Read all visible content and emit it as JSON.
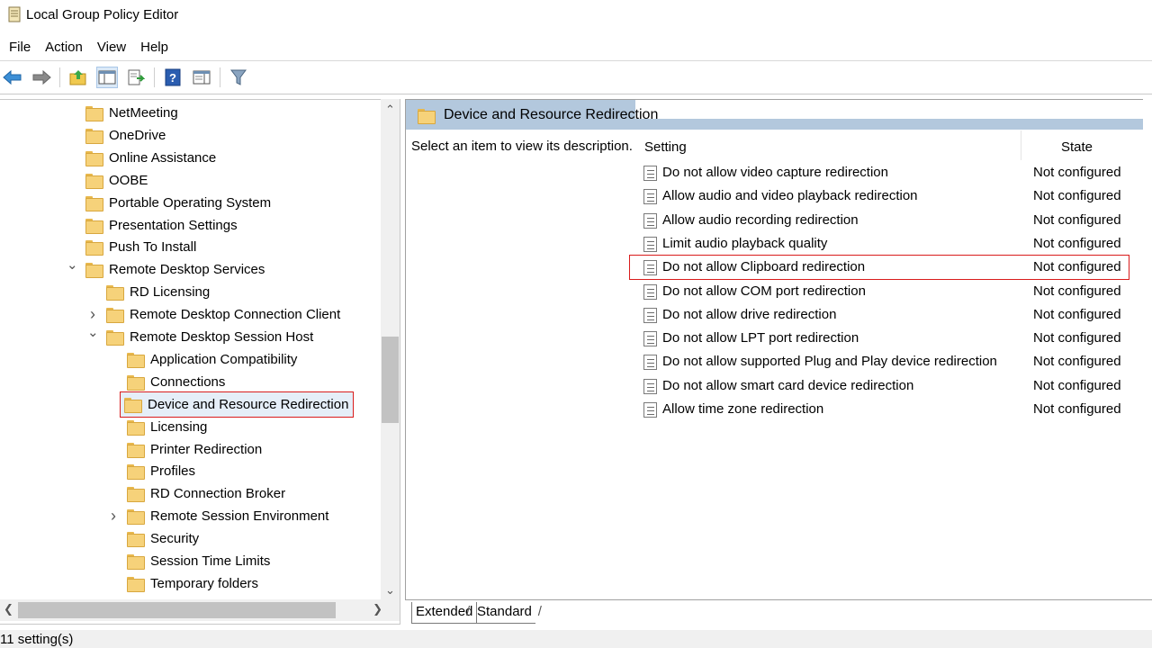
{
  "window": {
    "title": "Local Group Policy Editor"
  },
  "menu": [
    "File",
    "Action",
    "View",
    "Help"
  ],
  "toolbar": {
    "icons": [
      "back-arrow-icon",
      "forward-arrow-icon",
      "up-folder-icon",
      "show-hide-tree-icon",
      "export-list-icon",
      "help-icon",
      "properties-icon",
      "filter-icon"
    ]
  },
  "tree": {
    "items": [
      {
        "label": "NetMeeting",
        "level": 3
      },
      {
        "label": "OneDrive",
        "level": 3
      },
      {
        "label": "Online Assistance",
        "level": 3
      },
      {
        "label": "OOBE",
        "level": 3
      },
      {
        "label": "Portable Operating System",
        "level": 3
      },
      {
        "label": "Presentation Settings",
        "level": 3
      },
      {
        "label": "Push To Install",
        "level": 3
      },
      {
        "label": "Remote Desktop Services",
        "level": 3,
        "expander": "expanded"
      },
      {
        "label": "RD Licensing",
        "level": 4
      },
      {
        "label": "Remote Desktop Connection Client",
        "level": 4,
        "expander": "collapsed"
      },
      {
        "label": "Remote Desktop Session Host",
        "level": 4,
        "expander": "expanded"
      },
      {
        "label": "Application Compatibility",
        "level": 5
      },
      {
        "label": "Connections",
        "level": 5
      },
      {
        "label": "Device and Resource Redirection",
        "level": 5,
        "selected": true
      },
      {
        "label": "Licensing",
        "level": 5
      },
      {
        "label": "Printer Redirection",
        "level": 5
      },
      {
        "label": "Profiles",
        "level": 5
      },
      {
        "label": "RD Connection Broker",
        "level": 5
      },
      {
        "label": "Remote Session Environment",
        "level": 5,
        "expander": "collapsed"
      },
      {
        "label": "Security",
        "level": 5
      },
      {
        "label": "Session Time Limits",
        "level": 5
      },
      {
        "label": "Temporary folders",
        "level": 5
      }
    ]
  },
  "details": {
    "header": "Device and Resource Redirection",
    "description": "Select an item to view its description.",
    "columns": {
      "setting": "Setting",
      "state": "State"
    },
    "rows": [
      {
        "name": "Do not allow video capture redirection",
        "state": "Not configured"
      },
      {
        "name": "Allow audio and video playback redirection",
        "state": "Not configured"
      },
      {
        "name": "Allow audio recording redirection",
        "state": "Not configured"
      },
      {
        "name": "Limit audio playback quality",
        "state": "Not configured"
      },
      {
        "name": "Do not allow Clipboard redirection",
        "state": "Not configured",
        "highlighted": true
      },
      {
        "name": "Do not allow COM port redirection",
        "state": "Not configured"
      },
      {
        "name": "Do not allow drive redirection",
        "state": "Not configured"
      },
      {
        "name": "Do not allow LPT port redirection",
        "state": "Not configured"
      },
      {
        "name": "Do not allow supported Plug and Play device redirection",
        "state": "Not configured"
      },
      {
        "name": "Do not allow smart card device redirection",
        "state": "Not configured"
      },
      {
        "name": "Allow time zone redirection",
        "state": "Not configured"
      }
    ]
  },
  "tabs": {
    "extended": "Extended",
    "standard": "Standard"
  },
  "status": {
    "text": "11 setting(s)"
  },
  "colors": {
    "highlight_border": "#d91c1c",
    "header_band": "#b3c8dd",
    "folder": "#f6d27a"
  }
}
